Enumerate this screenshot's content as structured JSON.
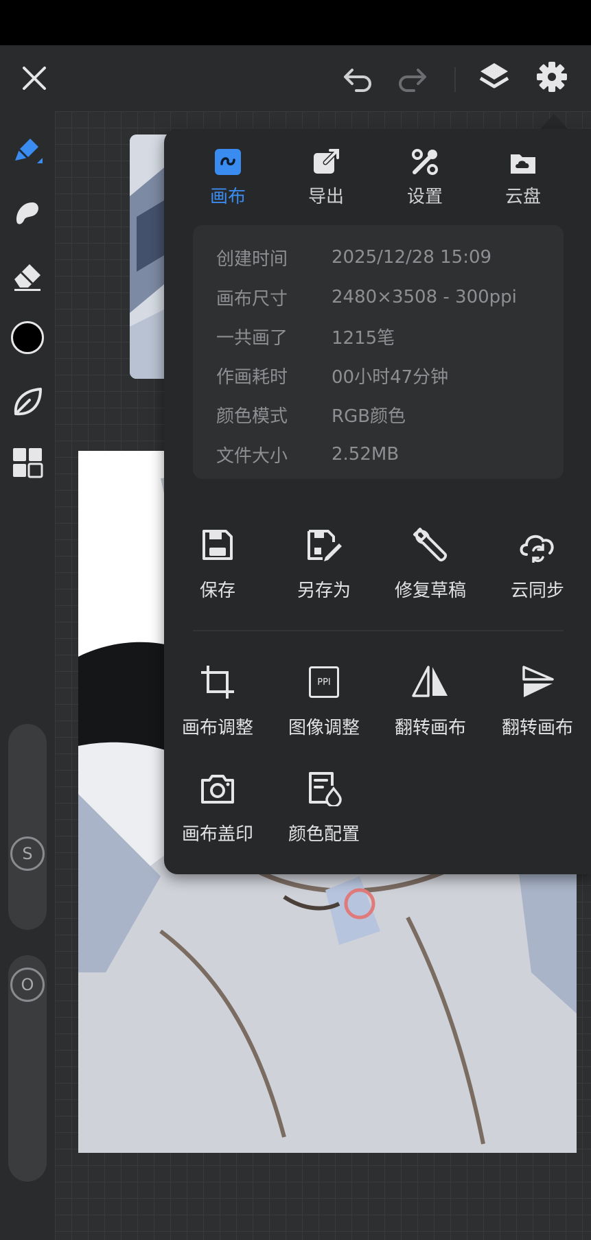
{
  "toolbar": {
    "close_icon": "close-icon",
    "undo_icon": "undo-icon",
    "redo_icon": "redo-icon",
    "layers_icon": "layers-icon",
    "settings_icon": "gear-icon"
  },
  "tools": [
    "brush-icon",
    "smudge-icon",
    "eraser-icon",
    "color-swatch",
    "leaf-icon",
    "grid-icon"
  ],
  "sliders": {
    "size_label": "S",
    "opacity_label": "O"
  },
  "menu": {
    "tabs": [
      {
        "label": "画布",
        "icon": "canvas-icon",
        "active": true
      },
      {
        "label": "导出",
        "icon": "export-icon",
        "active": false
      },
      {
        "label": "设置",
        "icon": "tools-icon",
        "active": false
      },
      {
        "label": "云盘",
        "icon": "cloud-drive-icon",
        "active": false
      }
    ],
    "info": [
      {
        "key": "创建时间",
        "value": "2025/12/28 15:09"
      },
      {
        "key": "画布尺寸",
        "value": "2480×3508 - 300ppi"
      },
      {
        "key": "一共画了",
        "value": "1215笔"
      },
      {
        "key": "作画耗时",
        "value": "00小时47分钟"
      },
      {
        "key": "颜色模式",
        "value": "RGB颜色"
      },
      {
        "key": "文件大小",
        "value": "2.52MB"
      }
    ],
    "actions_row1": [
      {
        "label": "保存",
        "icon": "save-icon"
      },
      {
        "label": "另存为",
        "icon": "save-as-icon"
      },
      {
        "label": "修复草稿",
        "icon": "wrench-icon"
      },
      {
        "label": "云同步",
        "icon": "cloud-sync-icon"
      }
    ],
    "actions_row2": [
      {
        "label": "画布调整",
        "icon": "crop-icon"
      },
      {
        "label": "图像调整",
        "icon": "ppi-icon",
        "badge": "PPI"
      },
      {
        "label": "翻转画布",
        "icon": "flip-horizontal-icon"
      },
      {
        "label": "翻转画布",
        "icon": "flip-vertical-icon"
      }
    ],
    "actions_row3": [
      {
        "label": "画布盖印",
        "icon": "camera-icon"
      },
      {
        "label": "颜色配置",
        "icon": "color-profile-icon"
      }
    ]
  },
  "colors": {
    "accent": "#3b8cf0",
    "panel": "#27282a",
    "info_bg": "#2f3032"
  }
}
